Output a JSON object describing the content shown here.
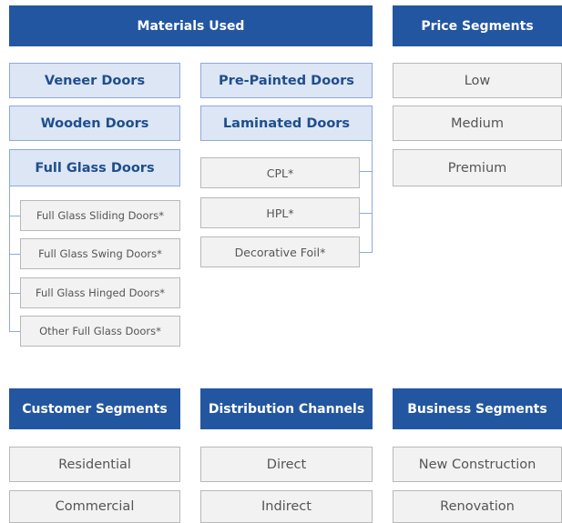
{
  "colors": {
    "header_bg": "#2356a0",
    "header_text": "#ffffff",
    "category_bg": "#dce6f4",
    "category_text": "#1f4e8c",
    "item_bg": "#f2f2f2",
    "item_text": "#555555",
    "connector": "#8eaadb"
  },
  "materials": {
    "header": "Materials Used",
    "veneer": "Veneer Doors",
    "pre_painted": "Pre-Painted Doors",
    "wooden": "Wooden Doors",
    "laminated": "Laminated Doors",
    "full_glass": "Full Glass Doors",
    "full_glass_subtypes": [
      "Full Glass Sliding Doors*",
      "Full Glass Swing Doors*",
      "Full Glass Hinged Doors*",
      "Other Full Glass Doors*"
    ],
    "laminated_subtypes": [
      "CPL*",
      "HPL*",
      "Decorative Foil*"
    ]
  },
  "price": {
    "header": "Price Segments",
    "items": [
      "Low",
      "Medium",
      "Premium"
    ]
  },
  "customer": {
    "header": "Customer Segments",
    "items": [
      "Residential",
      "Commercial"
    ]
  },
  "distribution": {
    "header": "Distribution Channels",
    "items": [
      "Direct",
      "Indirect"
    ]
  },
  "business": {
    "header": "Business Segments",
    "items": [
      "New Construction",
      "Renovation"
    ]
  }
}
